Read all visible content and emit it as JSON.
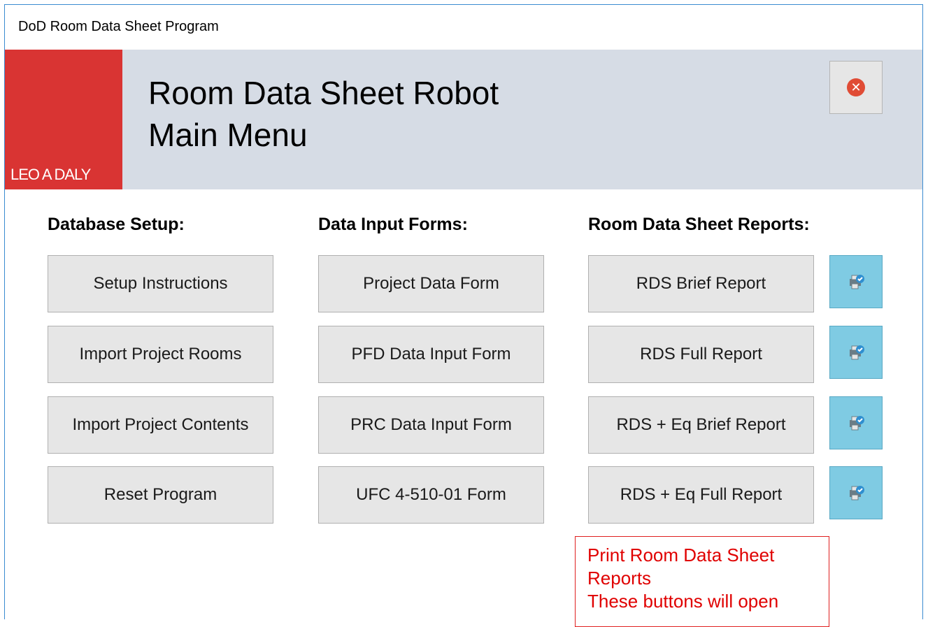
{
  "window": {
    "title": "DoD Room Data Sheet Program"
  },
  "banner": {
    "logo_text": "LEO A DALY",
    "title_line1": "Room Data Sheet Robot",
    "title_line2": "Main Menu"
  },
  "sections": {
    "database": {
      "header": "Database Setup:",
      "buttons": [
        "Setup Instructions",
        "Import Project Rooms",
        "Import Project Contents",
        "Reset Program"
      ]
    },
    "forms": {
      "header": "Data Input Forms:",
      "buttons": [
        "Project Data Form",
        "PFD Data Input Form",
        "PRC Data Input Form",
        "UFC 4-510-01 Form"
      ]
    },
    "reports": {
      "header": "Room Data Sheet Reports:",
      "buttons": [
        "RDS Brief Report",
        "RDS Full Report",
        "RDS + Eq Brief Report",
        "RDS + Eq Full Report"
      ]
    }
  },
  "note": {
    "line1": "Print Room Data Sheet",
    "line2": "Reports",
    "line3": "These buttons will open"
  },
  "colors": {
    "logo": "#d93433",
    "banner": "#d6dce5",
    "print_button": "#7fcbe3",
    "note_text": "#e00000"
  }
}
